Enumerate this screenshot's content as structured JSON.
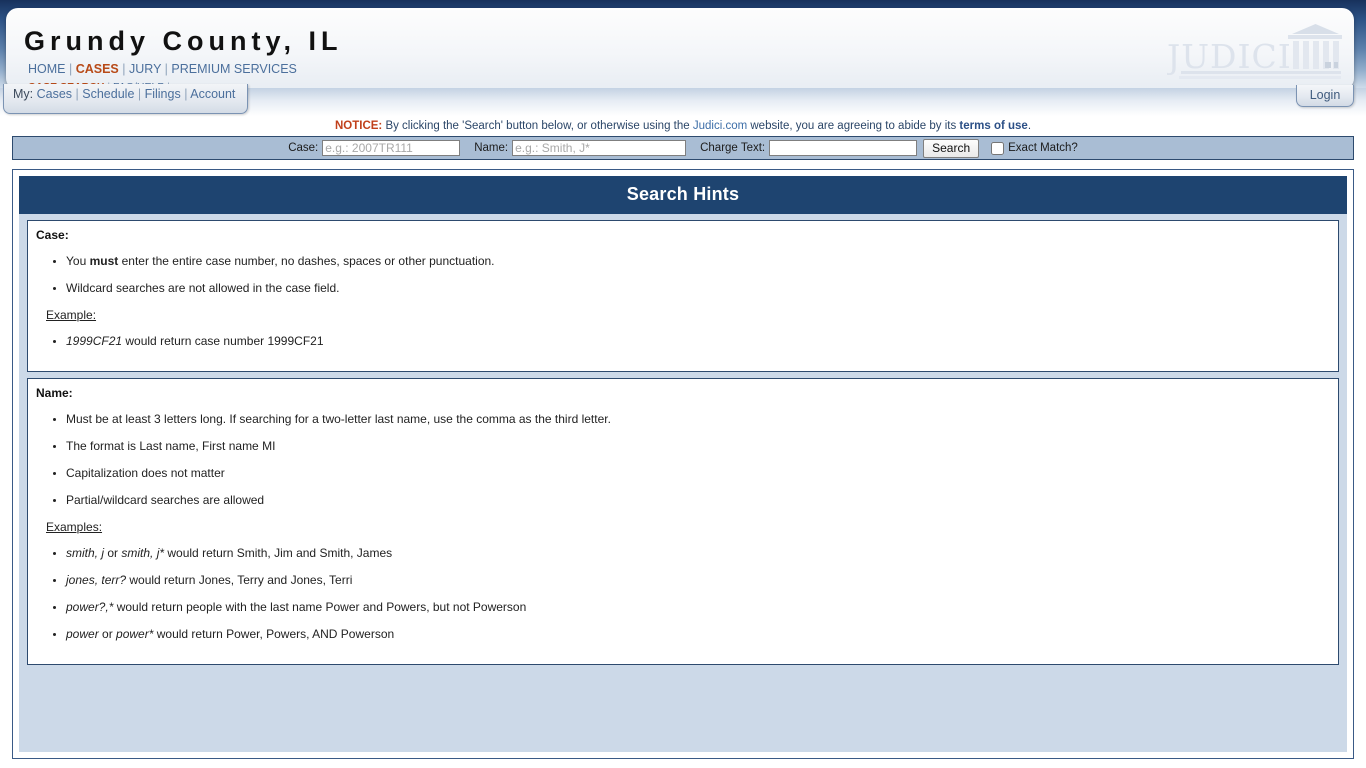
{
  "header": {
    "county_title": "Grundy County, IL",
    "nav_primary": [
      {
        "label": "HOME",
        "active": false
      },
      {
        "label": "CASES",
        "active": true
      },
      {
        "label": "JURY",
        "active": false
      },
      {
        "label": "PREMIUM SERVICES",
        "active": false
      }
    ],
    "nav_secondary": [
      {
        "label": "CASE SEARCH",
        "active": true
      },
      {
        "label": "FAQ/HELP",
        "active": false
      }
    ],
    "logo_text": "JUDICI",
    "logo_icon": "courthouse-icon"
  },
  "mybar": {
    "prefix": "My:",
    "items": [
      "Cases",
      "Schedule",
      "Filings",
      "Account"
    ]
  },
  "login": {
    "label": "Login"
  },
  "notice": {
    "label": "NOTICE:",
    "text_before_link": " By clicking the 'Search' button below, or otherwise using the ",
    "site_link": "Judici.com",
    "text_middle": " website, you are agreeing to abide by its ",
    "terms_link": "terms of use",
    "text_end": "."
  },
  "search": {
    "case_label": "Case:",
    "case_value": "",
    "case_placeholder": "e.g.: 2007TR111",
    "name_label": "Name:",
    "name_value": "",
    "name_placeholder": "e.g.: Smith, J*",
    "charge_label": "Charge Text:",
    "charge_value": "",
    "charge_placeholder": "",
    "search_button": "Search",
    "exact_match_label": "Exact Match?",
    "exact_match_checked": false
  },
  "hints": {
    "title": "Search Hints",
    "case": {
      "heading": "Case:",
      "bullets": [
        "You must enter the entire case number, no dashes, spaces or other punctuation.",
        "Wildcard searches are not allowed in the case field."
      ],
      "example_label": "Example:",
      "examples": [
        "1999CF21 would return case number 1999CF21"
      ]
    },
    "name": {
      "heading": "Name:",
      "bullets": [
        "Must be at least 3 letters long. If searching for a two-letter last name, use the comma as the third letter.",
        "The format is Last name, First name MI",
        "Capitalization does not matter",
        "Partial/wildcard searches are allowed"
      ],
      "example_label": "Examples:",
      "examples": [
        "smith, j or smith, j* would return Smith, Jim and Smith, James",
        "jones, terr? would return Jones, Terry and Jones, Terri",
        "power?,* would return people with the last name Power and Powers, but not Powerson",
        "power or power* would return Power, Powers, AND Powerson"
      ]
    }
  },
  "colors": {
    "banner_navy": "#1e4470",
    "accent_orange": "#b84a18",
    "link_blue": "#4b6f9c",
    "searchbar_bg": "#a9bdd4",
    "panel_bg": "#ccd9e8"
  }
}
